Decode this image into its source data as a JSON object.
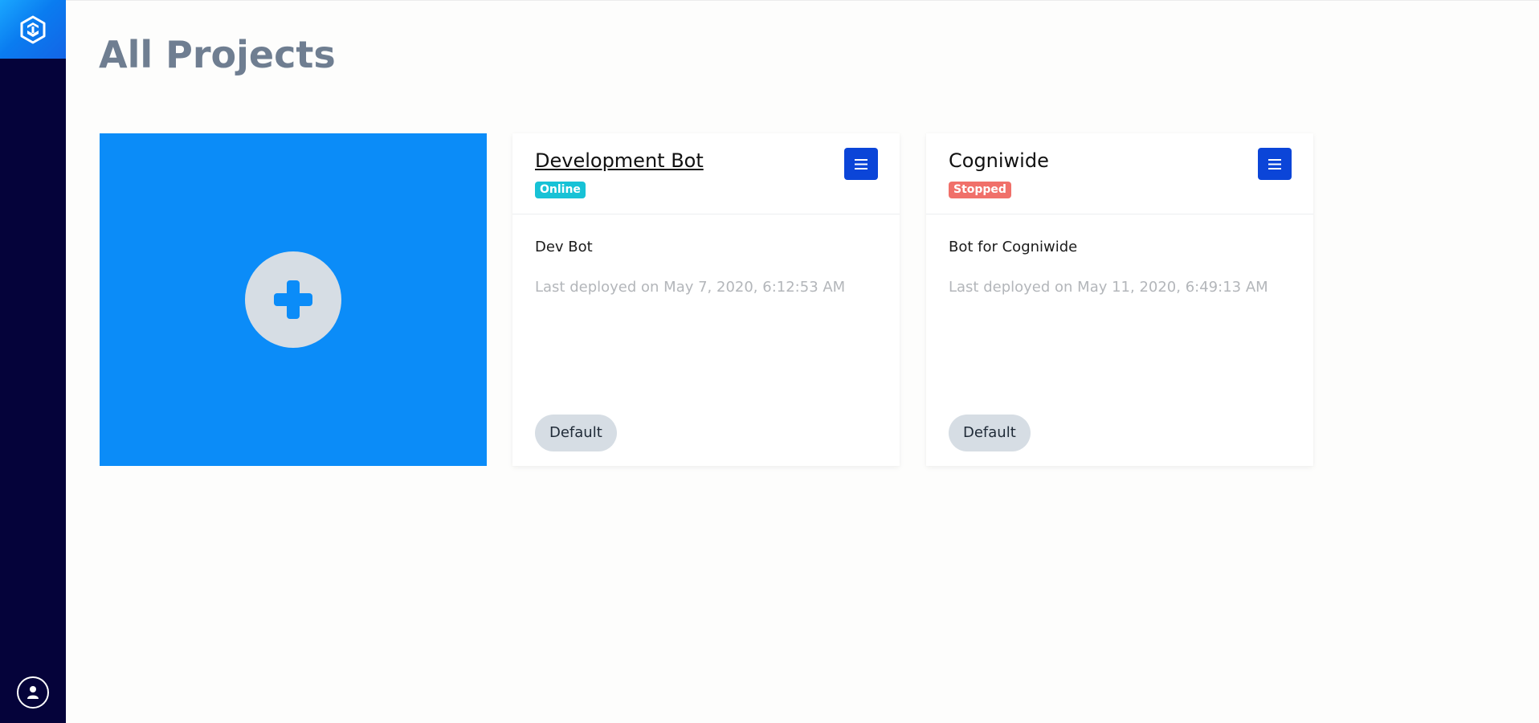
{
  "sidebar": {
    "logo_icon": "app-logo-icon",
    "user_icon": "user-icon",
    "logo_colors": [
      "#1aa7ff",
      "#1365e6"
    ],
    "background": "#05033a"
  },
  "main": {
    "title": "All Projects",
    "new_project": {
      "icon": "plus-circle-icon",
      "color": "#0b8cf8"
    },
    "projects": [
      {
        "name": "Development Bot",
        "status": "Online",
        "status_color": "#17c2d6",
        "description": "Dev Bot",
        "last_deployed": "Last deployed on May 7, 2020, 6:12:53 AM",
        "environment": "Default",
        "menu_icon": "hamburger-menu-icon"
      },
      {
        "name": "Cogniwide",
        "status": "Stopped",
        "status_color": "#f0706a",
        "description": "Bot for Cogniwide",
        "last_deployed": "Last deployed on May 11, 2020, 6:49:13 AM",
        "environment": "Default",
        "menu_icon": "hamburger-menu-icon"
      }
    ]
  }
}
